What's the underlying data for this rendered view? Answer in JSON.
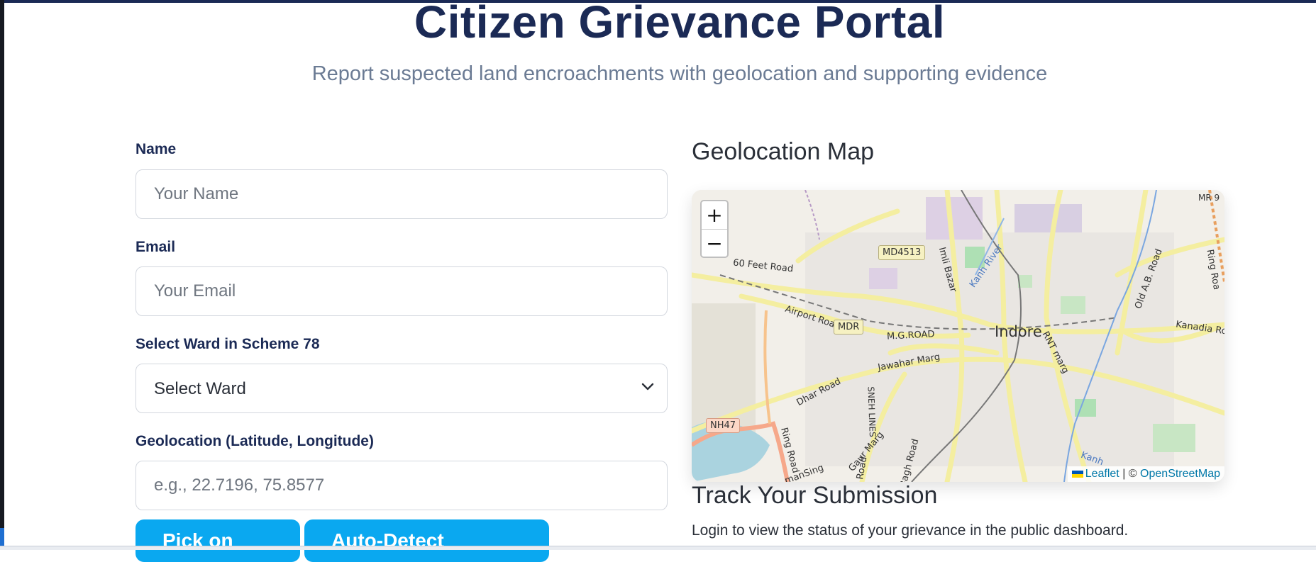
{
  "header": {
    "title": "Citizen Grievance Portal",
    "subtitle": "Report suspected land encroachments with geolocation and supporting evidence"
  },
  "form": {
    "name": {
      "label": "Name",
      "placeholder": "Your Name",
      "value": ""
    },
    "email": {
      "label": "Email",
      "placeholder": "Your Email",
      "value": ""
    },
    "ward": {
      "label": "Select Ward in Scheme 78",
      "selected": "Select Ward"
    },
    "geolocation": {
      "label": "Geolocation (Latitude, Longitude)",
      "placeholder": "e.g., 22.7196, 75.8577",
      "value": ""
    },
    "pick_on_map_label": "Pick on Map",
    "auto_detect_label": "Auto-Detect Location"
  },
  "map": {
    "heading": "Geolocation Map",
    "zoom_in": "+",
    "zoom_out": "−",
    "city": "Indore",
    "labels": {
      "md4513": "MD4513",
      "sixty_feet": "60 Feet Road",
      "imli_bazar": "Imli Bazar",
      "airport_road": "Airport Road",
      "mdr": "MDR",
      "mg_road": "M.G.ROAD",
      "jawahar_marg": "Jawahar Marg",
      "dhar_road": "Dhar Road",
      "nh47": "NH47",
      "ring_road": "Ring Road",
      "mr9": "MR 9",
      "old_ab_road": "Old A.B. Road",
      "kanadia": "Kanadia Roa",
      "ring_road_east": "Ring Roa",
      "rnt_marg": "RNT marg",
      "sneh_lines": "SNEH LINES",
      "baghi_road": "Bagh Road",
      "gaur_marg": "Gaur Marg",
      "manising": "manSing",
      "kanh_river": "Kanh River",
      "kanh_south": "Kanh",
      "road_south": "Road"
    },
    "attribution": {
      "leaflet": "Leaflet",
      "separator": "|",
      "copyright": "©",
      "osm": "OpenStreetMap"
    }
  },
  "track": {
    "heading": "Track Your Submission",
    "text": "Login to view the status of your grievance in the public dashboard."
  },
  "colors": {
    "primary_text": "#1b2a55",
    "subtitle": "#6b7b94",
    "button": "#0aa8f0",
    "link": "#0078a8"
  }
}
